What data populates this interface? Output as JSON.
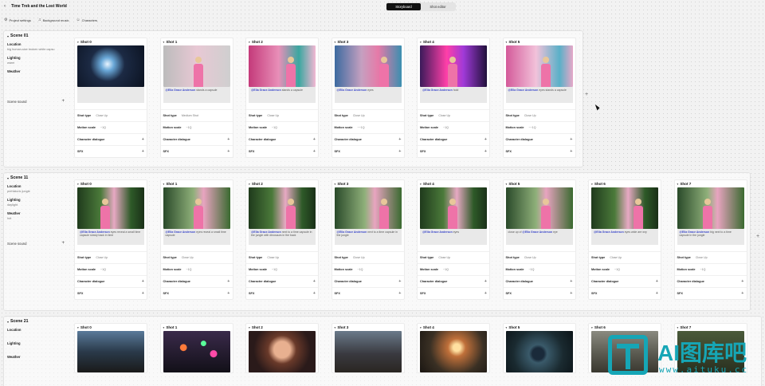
{
  "app": {
    "title": "Time Trek and the Lost World",
    "menu": [
      {
        "label": "Project settings",
        "icon": "gear-icon"
      },
      {
        "label": "Background music",
        "icon": "music-icon"
      },
      {
        "label": "Characters",
        "icon": "users-icon"
      }
    ],
    "tabs": [
      {
        "label": "Storyboard",
        "active": true
      },
      {
        "label": "Shot editor",
        "active": false
      }
    ]
  },
  "labels": {
    "location": "Location",
    "lighting": "Lighting",
    "weather": "Weather",
    "scene_sound": "Scene sound",
    "shot_type": "Shot type",
    "motion_scale": "Motion scale",
    "character_dialogue": "Character dialogue",
    "sfx": "SFX"
  },
  "scenes": [
    {
      "title": "Scene 01",
      "location": "big human-size broken white capsu",
      "lighting": "warm",
      "weather": "",
      "shots": [
        {
          "title": "Shot 0",
          "image": "img-robot",
          "girl": false,
          "mention": "",
          "prompt": "",
          "shot_type": "Close Up",
          "motion": "~1Q"
        },
        {
          "title": "Shot 1",
          "image": "img-pink1",
          "girl": true,
          "mention": "@Ella Grace Anderson",
          "prompt": " stands a capsule",
          "shot_type": "Medium Shot",
          "motion": "~1Q"
        },
        {
          "title": "Shot 2",
          "image": "img-pink2",
          "girl": true,
          "mention": "@Ella Grace Anderson",
          "prompt": " stands a capsule",
          "shot_type": "Close Up",
          "motion": "~1Q"
        },
        {
          "title": "Shot 3",
          "image": "img-pink3",
          "girl": true,
          "mention": "@Ella Grace Anderson",
          "prompt": " eyes",
          "shot_type": "Close Up",
          "motion": "~~1Q"
        },
        {
          "title": "Shot 4",
          "image": "img-neon",
          "girl": true,
          "mention": "@Ella Grace Anderson",
          "prompt": " hold",
          "shot_type": "Close Up",
          "motion": "~1Q"
        },
        {
          "title": "Shot 5",
          "image": "img-pink4",
          "girl": true,
          "mention": "@Ella Grace Anderson",
          "prompt": " eyes stands a capsule",
          "shot_type": "Close Up",
          "motion": "~~1Q"
        }
      ]
    },
    {
      "title": "Scene 11",
      "location": "prehistoric jungle",
      "lighting": "daylight",
      "weather": "hot",
      "shots": [
        {
          "title": "Shot 0",
          "image": "img-jungle",
          "girl": true,
          "mention": "@Ella Grace Anderson",
          "prompt": " eyes reveal a small time capsule slowly back in time",
          "shot_type": "Close Up",
          "motion": "~1Q"
        },
        {
          "title": "Shot 1",
          "image": "img-jungle2",
          "girl": true,
          "mention": "@Ella Grace Anderson",
          "prompt": " eyes reveal a small time capsule",
          "shot_type": "Close Up",
          "motion": "~1Q"
        },
        {
          "title": "Shot 2",
          "image": "img-jungle",
          "girl": true,
          "mention": "@Ella Grace Anderson",
          "prompt": " next to a time capsule in the jungle with dinosaurs in the back",
          "shot_type": "Close Up",
          "motion": "~1Q"
        },
        {
          "title": "Shot 3",
          "image": "img-jungle2",
          "girl": true,
          "mention": "@Ella Grace Anderson",
          "prompt": " next to a time capsule in the jungle",
          "shot_type": "Close Up",
          "motion": "~1Q"
        },
        {
          "title": "Shot 4",
          "image": "img-jungle",
          "girl": true,
          "mention": "@Ella Grace Anderson",
          "prompt": " eyes",
          "shot_type": "Close Up",
          "motion": "~1Q"
        },
        {
          "title": "Shot 5",
          "image": "img-jungle2",
          "girl": true,
          "mention": "@Ella Grace Anderson",
          "prompt": " eye",
          "prefix": "close up of ",
          "shot_type": "Close Up",
          "motion": "~1Q"
        },
        {
          "title": "Shot 6",
          "image": "img-jungle",
          "girl": true,
          "mention": "@Ella Grace Anderson",
          "prompt": " eyes wide are wry",
          "shot_type": "Close Up",
          "motion": "~1Q"
        },
        {
          "title": "Shot 7",
          "image": "img-jungle2",
          "girl": true,
          "mention": "@Ella Grace Anderson",
          "prompt": " big next to a time capsule in the jungle",
          "shot_type": "Close Up",
          "motion": "~1Q"
        }
      ]
    },
    {
      "title": "Scene 21",
      "location": "",
      "lighting": "",
      "weather": "",
      "shots": [
        {
          "title": "Shot 0",
          "image": "img-night1",
          "girl": false
        },
        {
          "title": "Shot 1",
          "image": "img-bokeh",
          "girl": false
        },
        {
          "title": "Shot 2",
          "image": "img-face",
          "girl": false
        },
        {
          "title": "Shot 3",
          "image": "img-rocks",
          "girl": false
        },
        {
          "title": "Shot 4",
          "image": "img-sunset",
          "girl": false
        },
        {
          "title": "Shot 5",
          "image": "img-orb",
          "girl": false
        },
        {
          "title": "Shot 6",
          "image": "img-stone",
          "girl": false
        },
        {
          "title": "Shot 7",
          "image": "img-blank",
          "girl": false
        }
      ]
    }
  ],
  "watermark": {
    "text": "AI图库吧",
    "url": "www.aituku.cc"
  }
}
